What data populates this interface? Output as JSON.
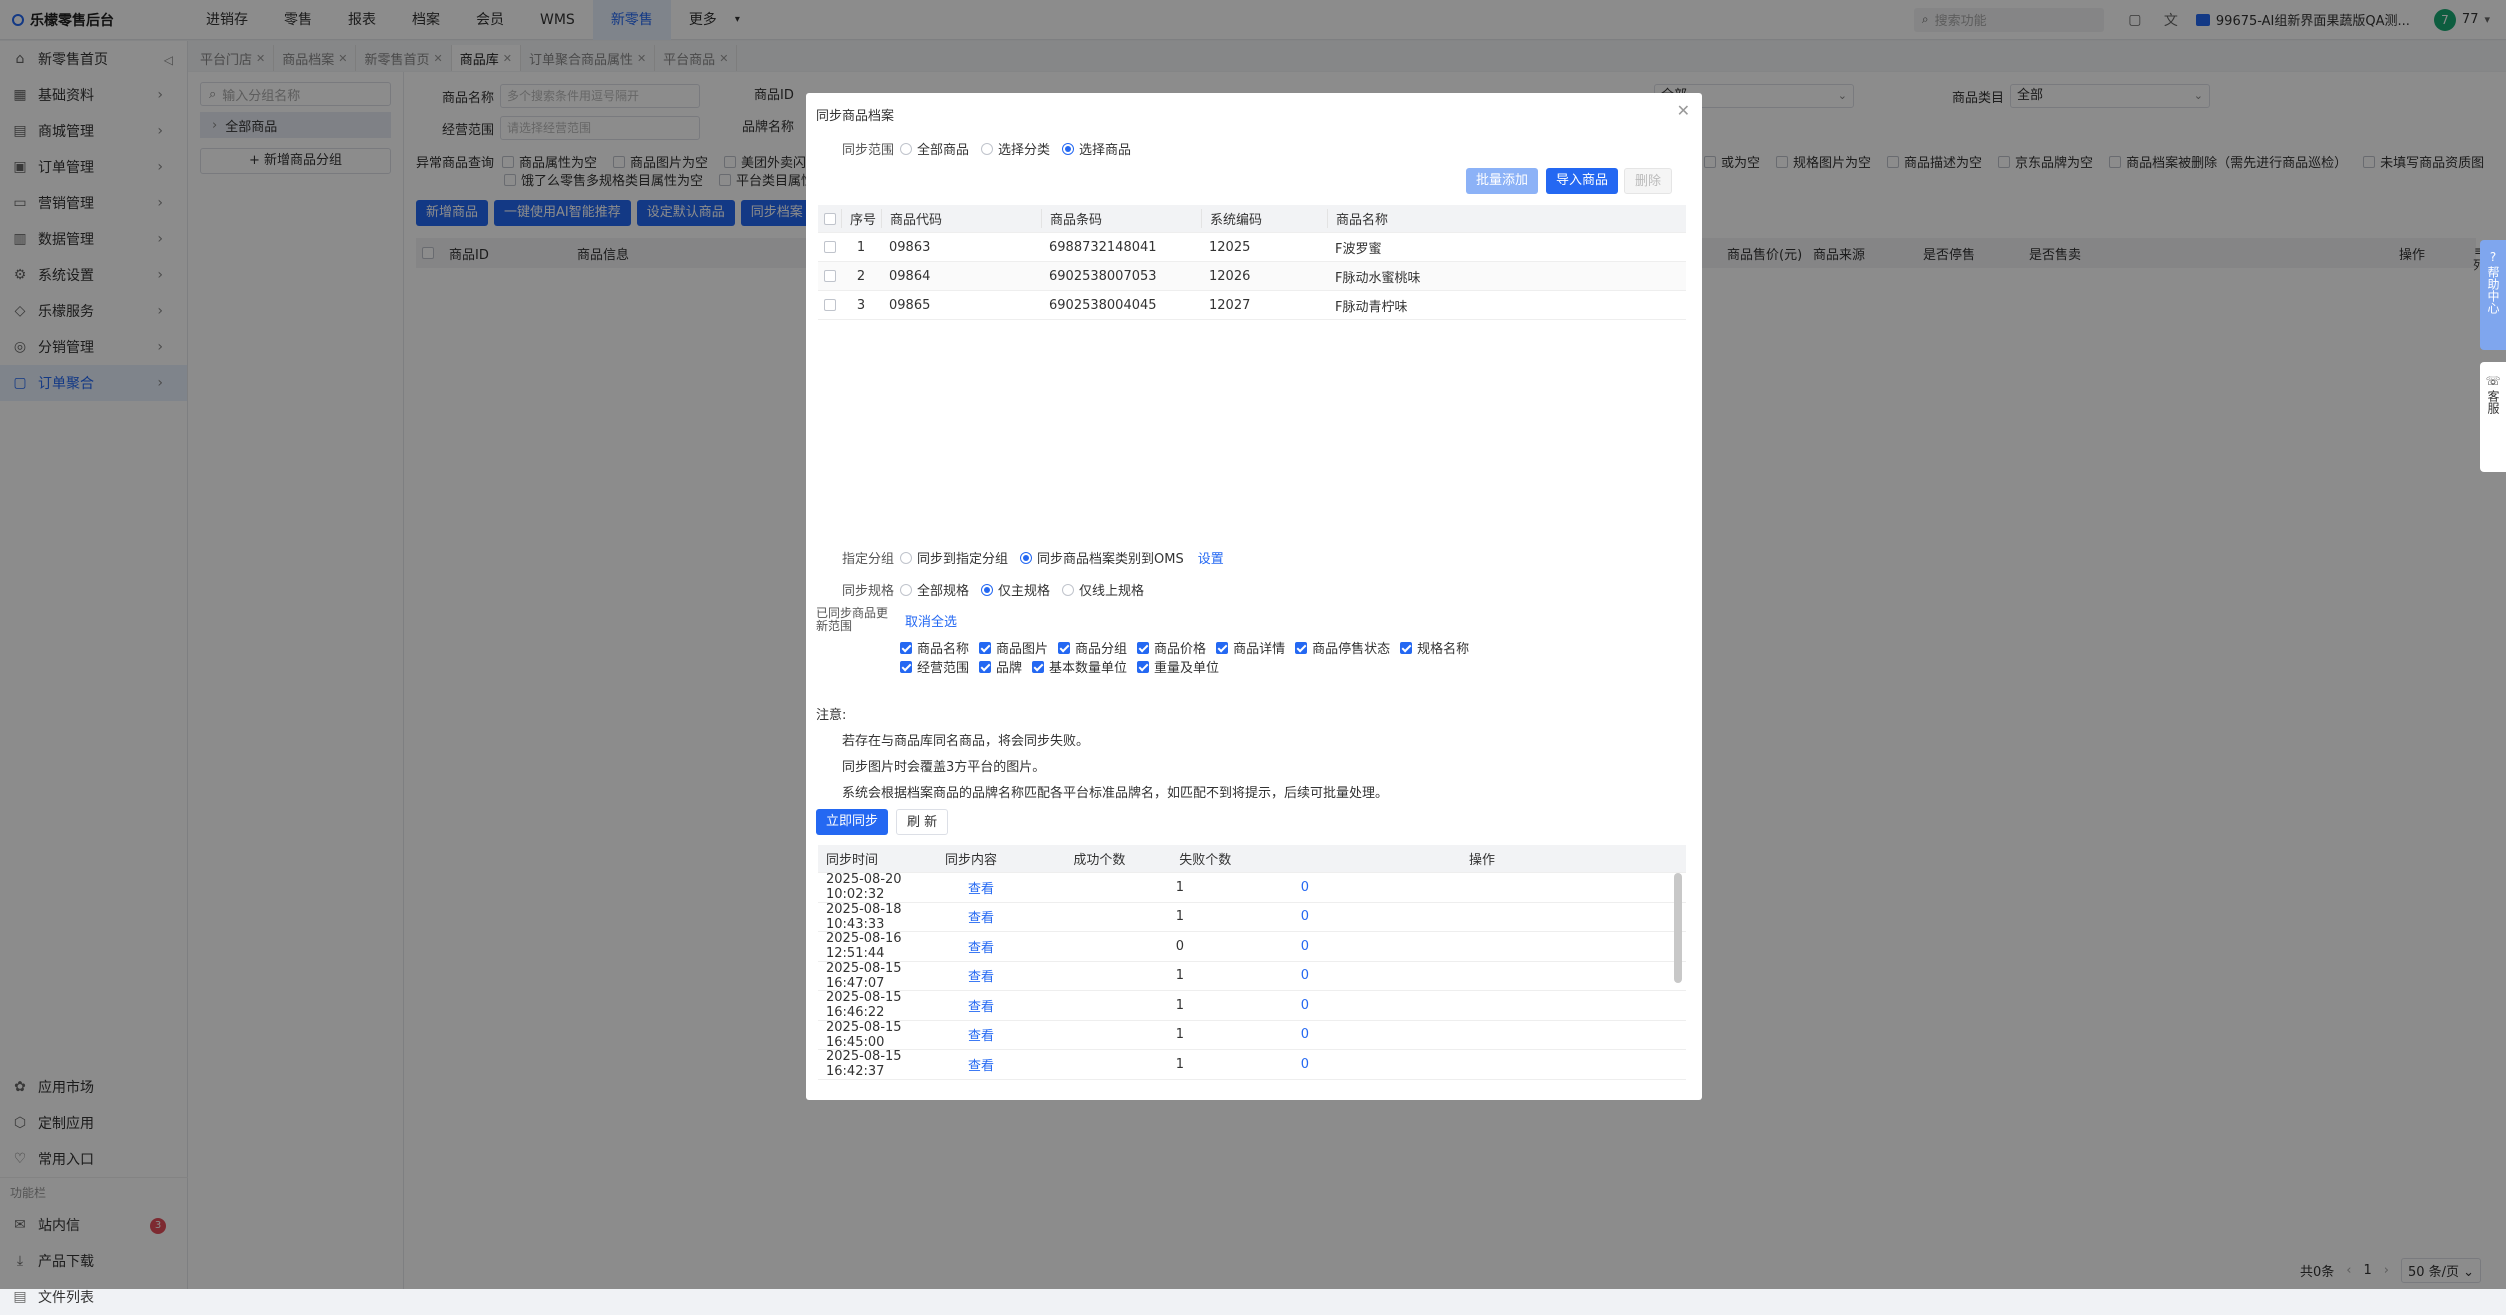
{
  "app": {
    "title": "乐檬零售后台"
  },
  "topnav": [
    "进销存",
    "零售",
    "报表",
    "档案",
    "会员",
    "WMS",
    "新零售",
    "更多"
  ],
  "topnav_active": 6,
  "top_right": {
    "search_placeholder": "搜索功能",
    "org": "99675-AI组新界面果蔬版QA测...",
    "avatar": "7",
    "user": "77"
  },
  "sidebar": {
    "items": [
      {
        "label": "新零售首页",
        "icon": "home-icon"
      },
      {
        "label": "基础资料",
        "icon": "grid-icon"
      },
      {
        "label": "商城管理",
        "icon": "store-icon"
      },
      {
        "label": "订单管理",
        "icon": "order-icon"
      },
      {
        "label": "营销管理",
        "icon": "marketing-icon"
      },
      {
        "label": "数据管理",
        "icon": "chart-icon"
      },
      {
        "label": "系统设置",
        "icon": "gear-icon"
      },
      {
        "label": "乐檬服务",
        "icon": "service-icon"
      },
      {
        "label": "分销管理",
        "icon": "distribution-icon"
      },
      {
        "label": "订单聚合",
        "icon": "aggregate-icon"
      }
    ],
    "active_index": 9,
    "footer": [
      {
        "label": "应用市场",
        "icon": "app-market-icon"
      },
      {
        "label": "定制应用",
        "icon": "custom-app-icon"
      },
      {
        "label": "常用入口",
        "icon": "heart-icon"
      }
    ],
    "section_label": "功能栏",
    "footer2": [
      {
        "label": "站内信",
        "icon": "mail-icon",
        "badge": "3"
      },
      {
        "label": "产品下载",
        "icon": "download-icon"
      },
      {
        "label": "文件列表",
        "icon": "file-icon"
      }
    ]
  },
  "tabs": [
    {
      "label": "平台门店"
    },
    {
      "label": "商品档案"
    },
    {
      "label": "新零售首页"
    },
    {
      "label": "商品库",
      "active": true
    },
    {
      "label": "订单聚合商品属性"
    },
    {
      "label": "平台商品"
    }
  ],
  "tree": {
    "search_placeholder": "输入分组名称",
    "root": "全部商品",
    "add_button": "+ 新增商品分组"
  },
  "filters": {
    "name_label": "商品名称",
    "name_placeholder": "多个搜索条件用逗号隔开",
    "id_label": "商品ID",
    "scope_label": "经营范围",
    "scope_placeholder": "请选择经营范围",
    "brand_label": "品牌名称",
    "source_value": "全部",
    "category_label": "商品类目",
    "category_value": "全部",
    "abnormal_label": "异常商品查询",
    "abnormal_left": [
      "商品属性为空",
      "商品图片为空",
      "美团外卖闪购"
    ],
    "abnormal_left2": [
      "饿了么零售多规格类目属性为空",
      "平台类目属性"
    ],
    "abnormal_right": [
      "或为空",
      "规格图片为空",
      "商品描述为空",
      "京东品牌为空",
      "商品档案被删除（需先进行商品巡检）",
      "未填写商品资质图"
    ]
  },
  "actions": [
    "新增商品",
    "一键使用AI智能推荐",
    "设定默认商品",
    "同步档案"
  ],
  "table_headers": [
    "商品ID",
    "商品信息",
    "商品售价(元)",
    "商品来源",
    "是否停售",
    "是否售卖",
    "操作"
  ],
  "column_toggle": "列",
  "right_float": {
    "help": "帮助中心",
    "kefu": "客服"
  },
  "pager": {
    "total": "共0条",
    "page": "1",
    "size": "50 条/页"
  },
  "modal": {
    "title": "同步商品档案",
    "scope_label": "同步范围",
    "scope_options": [
      "全部商品",
      "选择分类",
      "选择商品"
    ],
    "scope_selected": 2,
    "batch_add": "批量添加",
    "import_goods": "导入商品",
    "delete": "删除",
    "product_headers": [
      "序号",
      "商品代码",
      "商品条码",
      "系统编码",
      "商品名称"
    ],
    "products": [
      {
        "no": "1",
        "code": "09863",
        "barcode": "6988732148041",
        "sys": "12025",
        "name": "F波罗蜜"
      },
      {
        "no": "2",
        "code": "09864",
        "barcode": "6902538007053",
        "sys": "12026",
        "name": "F脉动水蜜桃味"
      },
      {
        "no": "3",
        "code": "09865",
        "barcode": "6902538004045",
        "sys": "12027",
        "name": "F脉动青柠味"
      }
    ],
    "group_label": "指定分组",
    "group_options": [
      "同步到指定分组",
      "同步商品档案类别到OMS"
    ],
    "group_selected": 1,
    "group_link": "设置",
    "spec_label": "同步规格",
    "spec_options": [
      "全部规格",
      "仅主规格",
      "仅线上规格"
    ],
    "spec_selected": 1,
    "update_label": "已同步商品更新范围",
    "cancel_all": "取消全选",
    "update_fields_row1": [
      "商品名称",
      "商品图片",
      "商品分组",
      "商品价格",
      "商品详情",
      "商品停售状态",
      "规格名称"
    ],
    "update_fields_row2": [
      "经营范围",
      "品牌",
      "基本数量单位",
      "重量及单位"
    ],
    "notes_title": "注意:",
    "notes": [
      "若存在与商品库同名商品，将会同步失败。",
      "同步图片时会覆盖3方平台的图片。",
      "系统会根据档案商品的品牌名称匹配各平台标准品牌名，如匹配不到将提示，后续可批量处理。"
    ],
    "sync_now": "立即同步",
    "refresh": "刷 新",
    "history_headers": [
      "同步时间",
      "同步内容",
      "成功个数",
      "失败个数",
      "操作"
    ],
    "history": [
      {
        "time": "2025-08-20 10:02:32",
        "content": "查看",
        "ok": "1",
        "fail": "0"
      },
      {
        "time": "2025-08-18 10:43:33",
        "content": "查看",
        "ok": "1",
        "fail": "0"
      },
      {
        "time": "2025-08-16 12:51:44",
        "content": "查看",
        "ok": "0",
        "fail": "0"
      },
      {
        "time": "2025-08-15 16:47:07",
        "content": "查看",
        "ok": "1",
        "fail": "0"
      },
      {
        "time": "2025-08-15 16:46:22",
        "content": "查看",
        "ok": "1",
        "fail": "0"
      },
      {
        "time": "2025-08-15 16:45:00",
        "content": "查看",
        "ok": "1",
        "fail": "0"
      },
      {
        "time": "2025-08-15 16:42:37",
        "content": "查看",
        "ok": "1",
        "fail": "0"
      }
    ]
  }
}
